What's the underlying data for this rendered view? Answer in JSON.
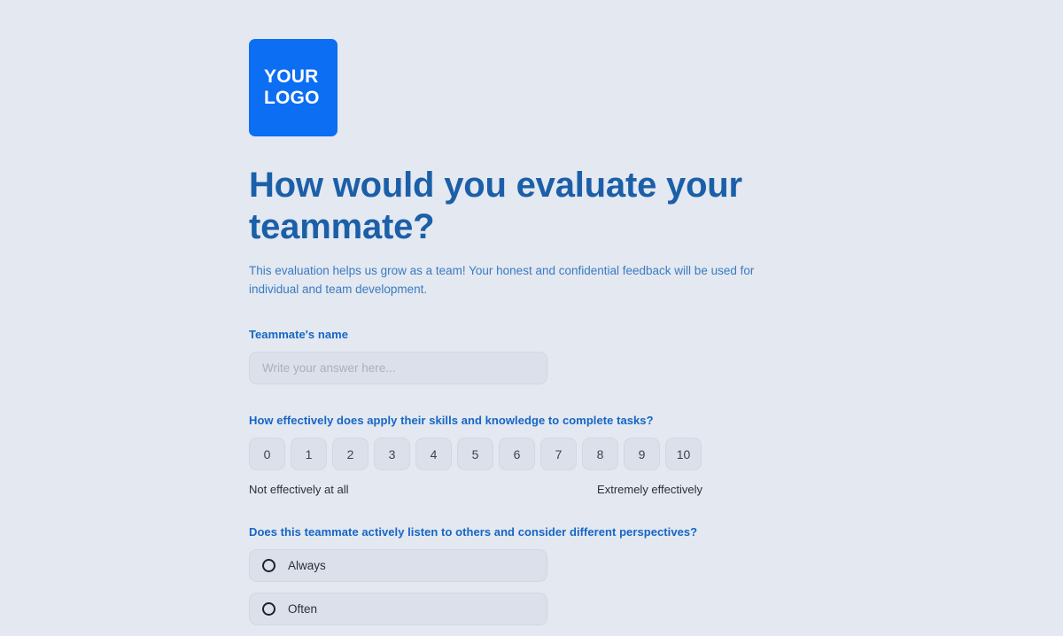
{
  "brand": {
    "logo_line1": "YOUR",
    "logo_line2": "LOGO",
    "logo_color": "#0c6ef2",
    "heading_color": "#1b5fa8",
    "label_color": "#1666c4"
  },
  "header": {
    "title": "How would you evaluate your teammate?",
    "subtitle": "This evaluation helps us grow as a team! Your honest and confidential feedback will be used for individual and team development."
  },
  "questions": [
    {
      "id": "teammate-name",
      "label": "Teammate's name",
      "type": "text",
      "value": "",
      "placeholder": "Write your answer here..."
    },
    {
      "id": "skills-rating",
      "label": "How effectively does apply their skills and knowledge to complete tasks?",
      "type": "scale",
      "options": [
        "0",
        "1",
        "2",
        "3",
        "4",
        "5",
        "6",
        "7",
        "8",
        "9",
        "10"
      ],
      "low_label": "Not effectively at all",
      "high_label": "Extremely effectively"
    },
    {
      "id": "listening",
      "label": "Does this teammate actively listen to others and consider different perspectives?",
      "type": "radio",
      "options": [
        {
          "label": "Always",
          "selected": false
        },
        {
          "label": "Often",
          "selected": false
        }
      ]
    }
  ]
}
